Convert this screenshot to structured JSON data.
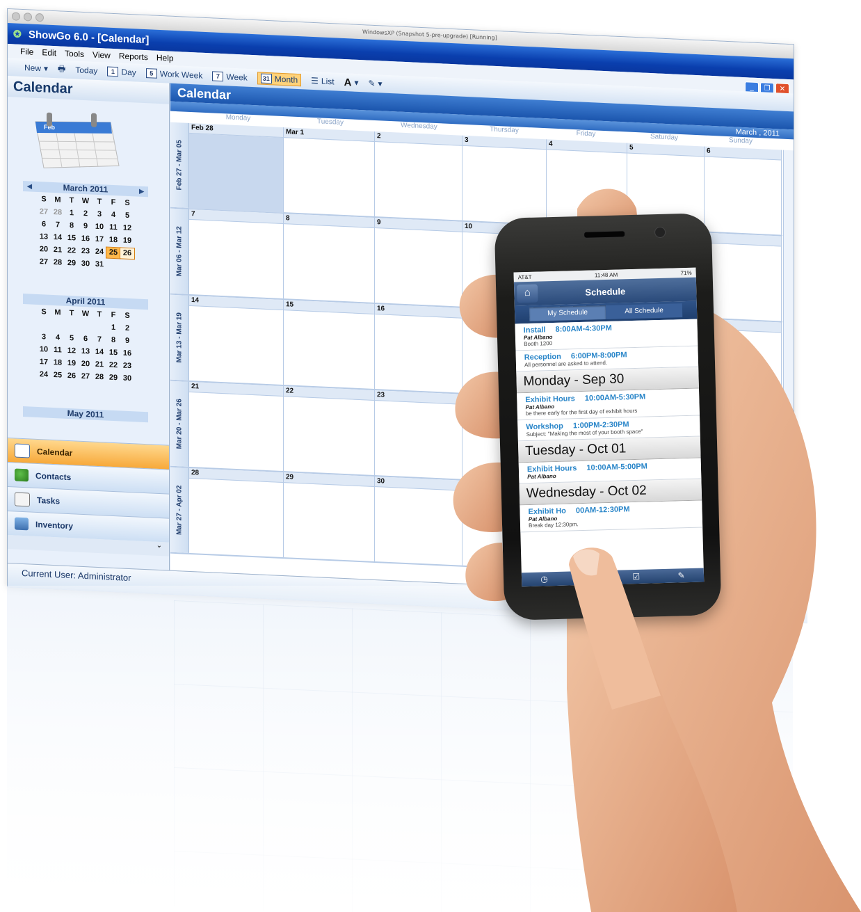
{
  "window": {
    "vm_title": "WindowsXP (Snapshot 5-pre-upgrade) [Running]",
    "app_title": "ShowGo 6.0 - [Calendar]",
    "menu": [
      "File",
      "Edit",
      "Tools",
      "View",
      "Reports",
      "Help"
    ],
    "toolbar": {
      "new_label": "New",
      "today_label": "Today",
      "day_label": "Day",
      "workweek_label": "Work Week",
      "week_label": "Week",
      "month_label": "Month",
      "list_label": "List",
      "day_icon": "1",
      "workweek_icon": "5",
      "week_icon": "7",
      "month_icon": "31"
    }
  },
  "sidebar": {
    "title": "Calendar",
    "graphic_label": "Feb",
    "calendars": [
      {
        "title": "March 2011",
        "dows": [
          "S",
          "M",
          "T",
          "W",
          "T",
          "F",
          "S"
        ],
        "rows": [
          [
            "27",
            "28",
            "1",
            "2",
            "3",
            "4",
            "5"
          ],
          [
            "6",
            "7",
            "8",
            "9",
            "10",
            "11",
            "12"
          ],
          [
            "13",
            "14",
            "15",
            "16",
            "17",
            "18",
            "19"
          ],
          [
            "20",
            "21",
            "22",
            "23",
            "24",
            "25",
            "26"
          ],
          [
            "27",
            "28",
            "29",
            "30",
            "31",
            "",
            ""
          ]
        ]
      },
      {
        "title": "April 2011",
        "dows": [
          "S",
          "M",
          "T",
          "W",
          "T",
          "F",
          "S"
        ],
        "rows": [
          [
            "",
            "",
            "",
            "",
            "",
            "1",
            "2"
          ],
          [
            "3",
            "4",
            "5",
            "6",
            "7",
            "8",
            "9"
          ],
          [
            "10",
            "11",
            "12",
            "13",
            "14",
            "15",
            "16"
          ],
          [
            "17",
            "18",
            "19",
            "20",
            "21",
            "22",
            "23"
          ],
          [
            "24",
            "25",
            "26",
            "27",
            "28",
            "29",
            "30"
          ]
        ]
      },
      {
        "title": "May 2011",
        "dows": [],
        "rows": []
      }
    ],
    "nav": [
      {
        "label": "Calendar",
        "icon": "calendar-icon"
      },
      {
        "label": "Contacts",
        "icon": "contacts-icon"
      },
      {
        "label": "Tasks",
        "icon": "tasks-icon"
      },
      {
        "label": "Inventory",
        "icon": "inventory-icon"
      }
    ]
  },
  "status": {
    "current_user": "Current User: Administrator"
  },
  "main": {
    "title": "Calendar",
    "month_label": "March , 2011",
    "dows": [
      "Monday",
      "Tuesday",
      "Wednesday",
      "Thursday",
      "Friday",
      "Saturday",
      "Sunday"
    ],
    "weeks": [
      {
        "label": "Feb 27 - Mar 05",
        "days": [
          "Feb 28",
          "Mar 1",
          "2",
          "3",
          "4",
          "5",
          "6"
        ]
      },
      {
        "label": "Mar 06 - Mar 12",
        "days": [
          "7",
          "8",
          "9",
          "10",
          "",
          "",
          ""
        ]
      },
      {
        "label": "Mar 13 - Mar 19",
        "days": [
          "14",
          "15",
          "16",
          "",
          "",
          "",
          ""
        ]
      },
      {
        "label": "Mar 20 - Mar 26",
        "days": [
          "21",
          "22",
          "23",
          "",
          "",
          "",
          ""
        ]
      },
      {
        "label": "Mar 27 - Apr 02",
        "days": [
          "28",
          "29",
          "30",
          "",
          "",
          "",
          ""
        ]
      }
    ]
  },
  "phone": {
    "carrier": "AT&T",
    "time": "11:48 AM",
    "battery": "71%",
    "title": "Schedule",
    "tabs": [
      "My Schedule",
      "All Schedule"
    ],
    "items": [
      {
        "type": "event",
        "name": "Install",
        "time": "8:00AM-4:30PM",
        "person": "Pat Albano",
        "note": "Booth 1200"
      },
      {
        "type": "event",
        "name": "Reception",
        "time": "6:00PM-8:00PM",
        "person": "",
        "note": "All personnel are asked to attend."
      },
      {
        "type": "day",
        "label": "Monday - Sep 30"
      },
      {
        "type": "event",
        "name": "Exhibit Hours",
        "time": "10:00AM-5:30PM",
        "person": "Pat Albano",
        "note": "be there early for the first day of exhibit hours"
      },
      {
        "type": "event",
        "name": "Workshop",
        "time": "1:00PM-2:30PM",
        "person": "",
        "note": "Subject: \"Making the most of your booth space\""
      },
      {
        "type": "day",
        "label": "Tuesday - Oct 01"
      },
      {
        "type": "event",
        "name": "Exhibit Hours",
        "time": "10:00AM-5:00PM",
        "person": "Pat Albano",
        "note": ""
      },
      {
        "type": "day",
        "label": "Wednesday - Oct 02"
      },
      {
        "type": "event",
        "name": "Exhibit Ho",
        "time": "00AM-12:30PM",
        "person": "Pat Albano",
        "note": "Break day 12:30pm."
      }
    ]
  },
  "colors": {
    "accent": "#0a3fae",
    "highlight": "#ffb84a",
    "phone_link": "#2a86c9"
  }
}
